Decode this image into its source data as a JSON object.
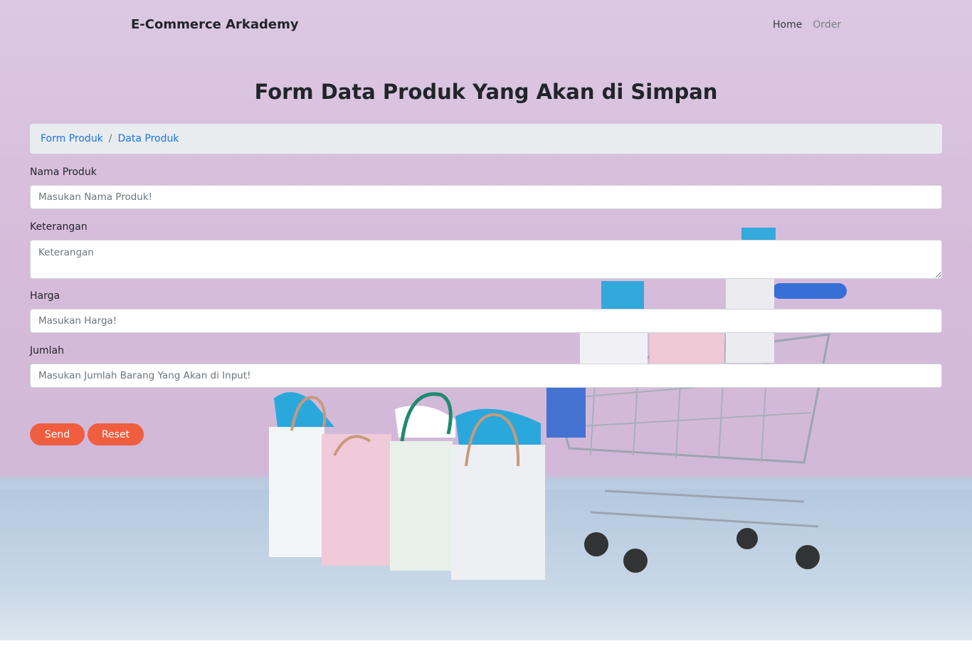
{
  "navbar": {
    "brand": "E-Commerce Arkademy",
    "links": [
      {
        "label": "Home"
      },
      {
        "label": "Order"
      }
    ]
  },
  "page": {
    "title": "Form Data Produk Yang Akan di Simpan"
  },
  "breadcrumb": [
    {
      "label": "Form Produk"
    },
    {
      "label": "Data Produk"
    }
  ],
  "breadcrumb_separator": "/",
  "form": {
    "nama_produk": {
      "label": "Nama Produk",
      "placeholder": "Masukan Nama Produk!",
      "value": ""
    },
    "keterangan": {
      "label": "Keterangan",
      "placeholder": "Keterangan",
      "value": ""
    },
    "harga": {
      "label": "Harga",
      "placeholder": "Masukan Harga!",
      "value": ""
    },
    "jumlah": {
      "label": "Jumlah",
      "placeholder": "Masukan Jumlah Barang Yang Akan di Input!",
      "value": ""
    },
    "send_label": "Send",
    "reset_label": "Reset"
  },
  "colors": {
    "accent": "#ef5e3f",
    "link": "#1a73e8",
    "breadcrumb_bg": "#e9ecef"
  }
}
